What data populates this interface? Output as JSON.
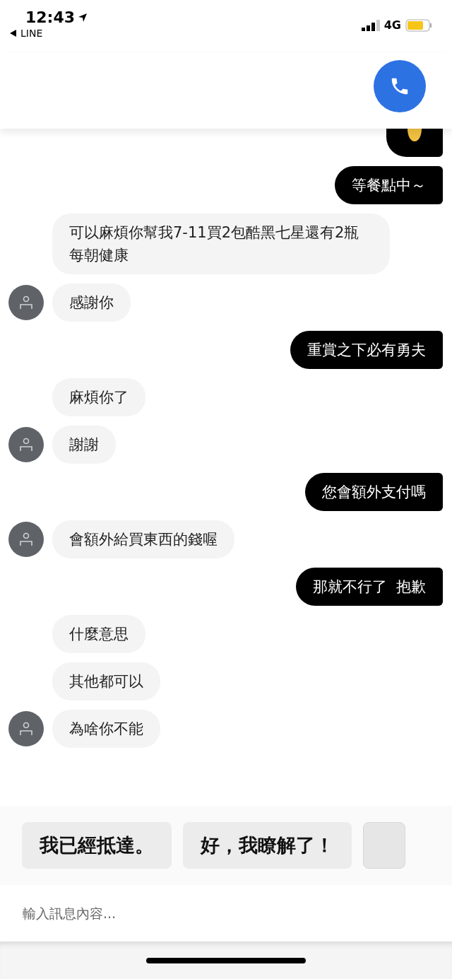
{
  "status_bar": {
    "time": "12:43",
    "back_label": "LINE",
    "network": "4G"
  },
  "messages": [
    {
      "kind": "outgoing_sticker"
    },
    {
      "kind": "outgoing",
      "text": "等餐點中～"
    },
    {
      "kind": "incoming",
      "text": "可以麻煩你幫我7-11買2包酷黑七星還有2瓶每朝健康",
      "avatar": false
    },
    {
      "kind": "incoming",
      "text": "感謝你",
      "avatar": true
    },
    {
      "kind": "outgoing",
      "text": "重賞之下必有勇夫"
    },
    {
      "kind": "incoming",
      "text": "麻煩你了",
      "avatar": false
    },
    {
      "kind": "incoming",
      "text": "謝謝",
      "avatar": true
    },
    {
      "kind": "outgoing",
      "text": "您會額外支付嗎"
    },
    {
      "kind": "incoming",
      "text": "會額外給買東西的錢喔",
      "avatar": true
    },
    {
      "kind": "outgoing",
      "text": "那就不行了  抱歉"
    },
    {
      "kind": "incoming",
      "text": "什麼意思",
      "avatar": false
    },
    {
      "kind": "incoming",
      "text": "其他都可以",
      "avatar": false
    },
    {
      "kind": "incoming",
      "text": "為啥你不能",
      "avatar": true
    }
  ],
  "quick_replies": [
    "我已經抵達。",
    "好，我瞭解了！"
  ],
  "input": {
    "placeholder": "輸入訊息內容..."
  }
}
